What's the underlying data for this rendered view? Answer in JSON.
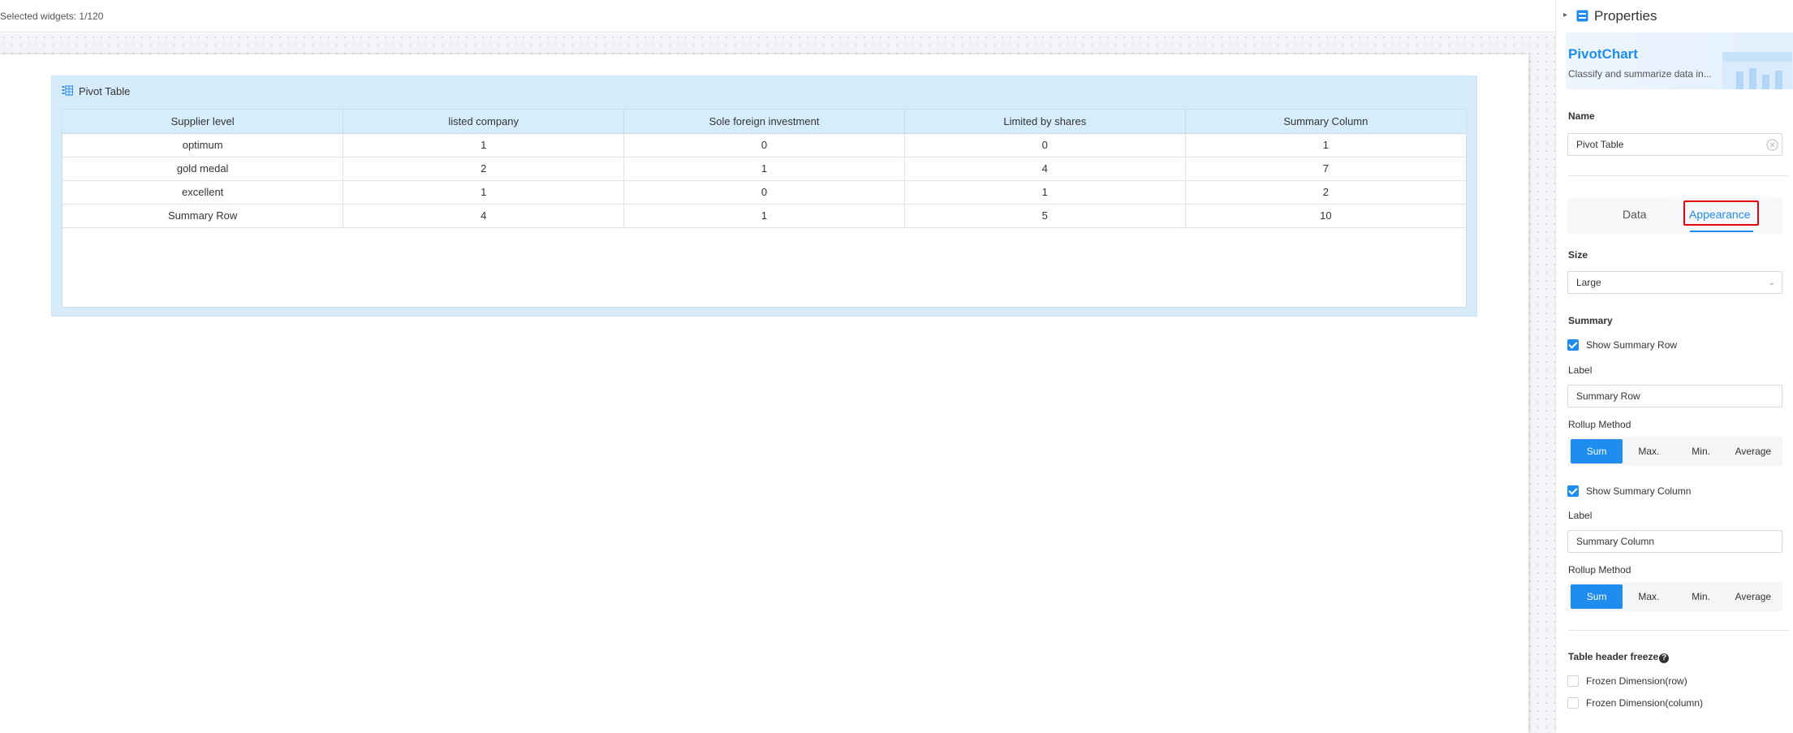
{
  "topbar": {
    "selected_text": "Selected widgets: 1/120"
  },
  "widget": {
    "title": "Pivot Table",
    "table": {
      "headers": [
        "Supplier level",
        "listed company",
        "Sole foreign investment",
        "Limited by shares",
        "Summary Column"
      ],
      "rows": [
        [
          "optimum",
          "1",
          "0",
          "0",
          "1"
        ],
        [
          "gold medal",
          "2",
          "1",
          "4",
          "7"
        ],
        [
          "excellent",
          "1",
          "0",
          "1",
          "2"
        ],
        [
          "Summary Row",
          "4",
          "1",
          "5",
          "10"
        ]
      ]
    }
  },
  "panel": {
    "title": "Properties",
    "component_name": "PivotChart",
    "component_desc": "Classify and summarize data in...",
    "name_label": "Name",
    "name_value": "Pivot Table",
    "tabs": {
      "data": "Data",
      "appearance": "Appearance"
    },
    "active_tab": "appearance",
    "size_label": "Size",
    "size_value": "Large",
    "summary_label": "Summary",
    "show_summary_row": "Show Summary Row",
    "show_summary_row_checked": true,
    "row_label_label": "Label",
    "row_label_value": "Summary Row",
    "row_rollup_label": "Rollup Method",
    "rollup_options": [
      "Sum",
      "Max.",
      "Min.",
      "Average"
    ],
    "row_rollup_selected": "Sum",
    "show_summary_col": "Show Summary Column",
    "show_summary_col_checked": true,
    "col_label_label": "Label",
    "col_label_value": "Summary Column",
    "col_rollup_label": "Rollup Method",
    "col_rollup_selected": "Sum",
    "freeze_label": "Table header freeze",
    "freeze_help": "?",
    "frozen_row": "Frozen Dimension(row)",
    "frozen_row_checked": false,
    "frozen_col": "Frozen Dimension(column)",
    "frozen_col_checked": false
  },
  "colors": {
    "accent": "#1f8cf0",
    "highlight": "#e60012",
    "widget_bg": "#d7ecfb"
  },
  "icons": [
    "pivot-table-icon",
    "properties-icon",
    "clear-icon",
    "chevron-down-icon",
    "help-icon"
  ]
}
